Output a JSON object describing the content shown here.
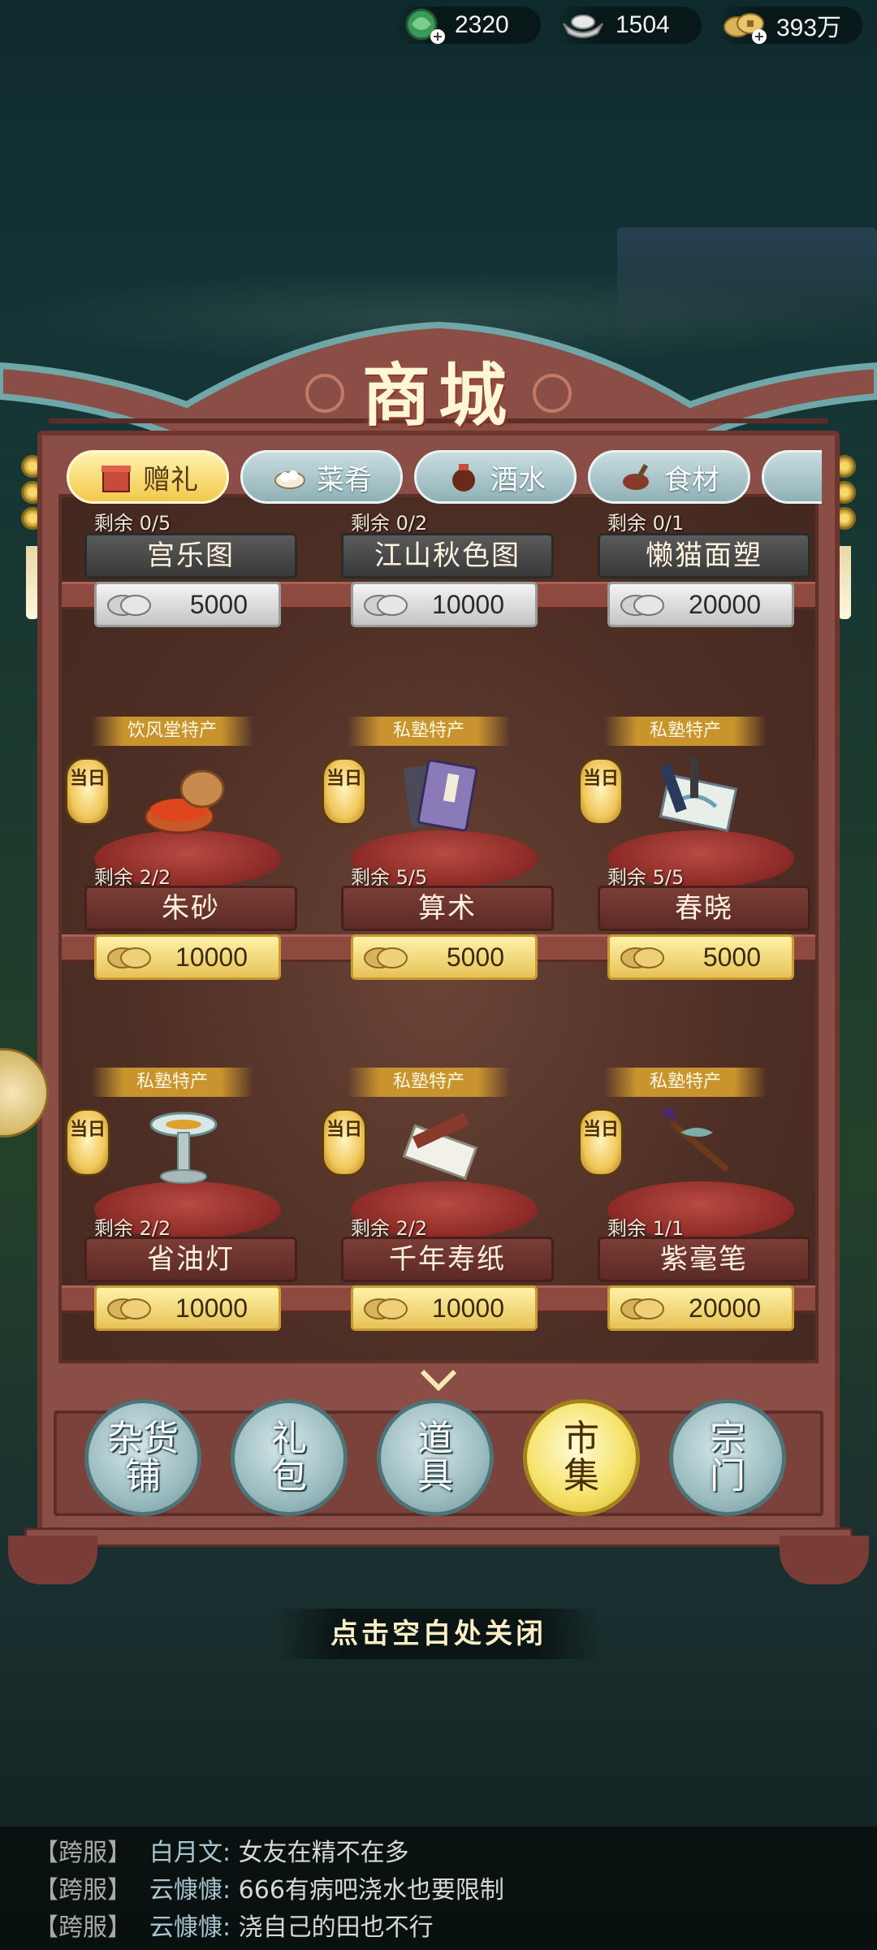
{
  "resources": [
    {
      "icon": "jade-coin-icon",
      "value": "2320"
    },
    {
      "icon": "silver-ingot-icon",
      "value": "1504"
    },
    {
      "icon": "copper-coins-icon",
      "value": "393万"
    }
  ],
  "shop": {
    "title": "商城",
    "tabs": [
      {
        "label": "赠礼",
        "icon": "gift-icon",
        "active": true
      },
      {
        "label": "菜肴",
        "icon": "dish-icon",
        "active": false
      },
      {
        "label": "酒水",
        "icon": "wine-jar-icon",
        "active": false
      },
      {
        "label": "食材",
        "icon": "ingredients-icon",
        "active": false
      },
      {
        "label": "",
        "icon": "more-tab-icon",
        "active": false
      }
    ],
    "top_row": [
      {
        "remain": "剩余 0/5",
        "name": "宫乐图",
        "price": "5000"
      },
      {
        "remain": "剩余 0/2",
        "name": "江山秋色图",
        "price": "10000"
      },
      {
        "remain": "剩余 0/1",
        "name": "懒猫面塑",
        "price": "20000"
      }
    ],
    "rows": [
      [
        {
          "badge": "饮风堂特产",
          "lantern": "当日",
          "remain": "剩余 2/2",
          "name": "朱砂",
          "price": "10000",
          "icon": "cinnabar-box-icon"
        },
        {
          "badge": "私塾特产",
          "lantern": "当日",
          "remain": "剩余 5/5",
          "name": "算术",
          "price": "5000",
          "icon": "books-icon"
        },
        {
          "badge": "私塾特产",
          "lantern": "当日",
          "remain": "剩余 5/5",
          "name": "春晓",
          "price": "5000",
          "icon": "scroll-painting-icon"
        }
      ],
      [
        {
          "badge": "私塾特产",
          "lantern": "当日",
          "remain": "剩余 2/2",
          "name": "省油灯",
          "price": "10000",
          "icon": "oil-lamp-icon"
        },
        {
          "badge": "私塾特产",
          "lantern": "当日",
          "remain": "剩余 2/2",
          "name": "千年寿纸",
          "price": "10000",
          "icon": "paper-stack-icon"
        },
        {
          "badge": "私塾特产",
          "lantern": "当日",
          "remain": "剩余 1/1",
          "name": "紫毫笔",
          "price": "20000",
          "icon": "brush-pen-icon"
        }
      ]
    ],
    "categories": [
      {
        "label": [
          "杂货",
          "铺"
        ],
        "active": false
      },
      {
        "label": [
          "礼",
          "包"
        ],
        "active": false
      },
      {
        "label": [
          "道",
          "具"
        ],
        "active": false
      },
      {
        "label": [
          "市",
          "集"
        ],
        "active": true
      },
      {
        "label": [
          "宗",
          "门"
        ],
        "active": false
      }
    ],
    "close_hint": "点击空白处关闭"
  },
  "chat": [
    {
      "tag": "【跨服】",
      "user": "白月文:",
      "msg": "女友在精不在多"
    },
    {
      "tag": "【跨服】",
      "user": "云慷慷:",
      "msg": "666有病吧浇水也要限制"
    },
    {
      "tag": "【跨服】",
      "user": "云慷慷:",
      "msg": "浇自己的田也不行"
    }
  ],
  "colors": {
    "gold": "#e6c257",
    "frame": "#8a4e46",
    "tab_active": "#f2c84a",
    "tab": "#8fb1b6"
  }
}
